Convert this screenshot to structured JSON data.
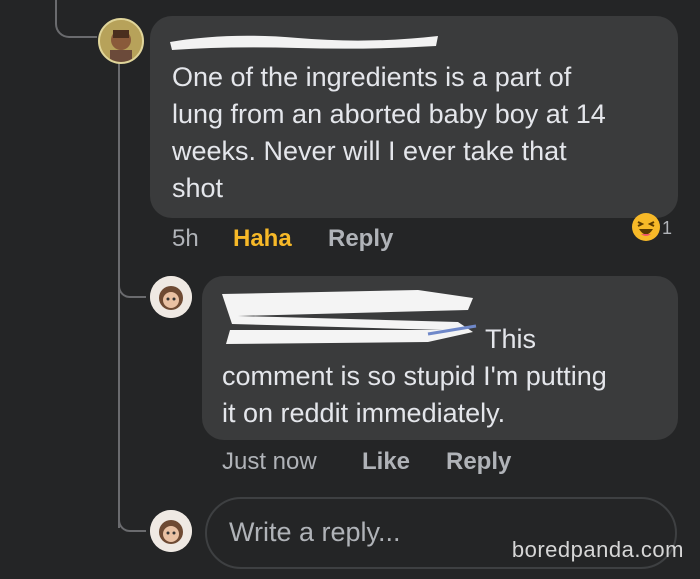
{
  "comment1": {
    "text": "One of the ingredients is a part of\nlung from an aborted baby boy at 14\nweeks.  Never will I ever take that\nshot",
    "time": "5h",
    "reaction_label": "Haha",
    "reply_label": "Reply",
    "reaction_count": "1",
    "reaction_icon": "haha-emoji-icon"
  },
  "comment2": {
    "text": "This\ncomment is so stupid I'm putting\nit on reddit immediately.",
    "time": "Just now",
    "like_label": "Like",
    "reply_label": "Reply"
  },
  "reply_box": {
    "placeholder": "Write a reply..."
  },
  "watermark": "boredpanda.com",
  "colors": {
    "background": "#242526",
    "bubble": "#3a3b3c",
    "reaction_active": "#f7b928",
    "text": "#e4e6eb",
    "muted": "#b0b3b8"
  }
}
